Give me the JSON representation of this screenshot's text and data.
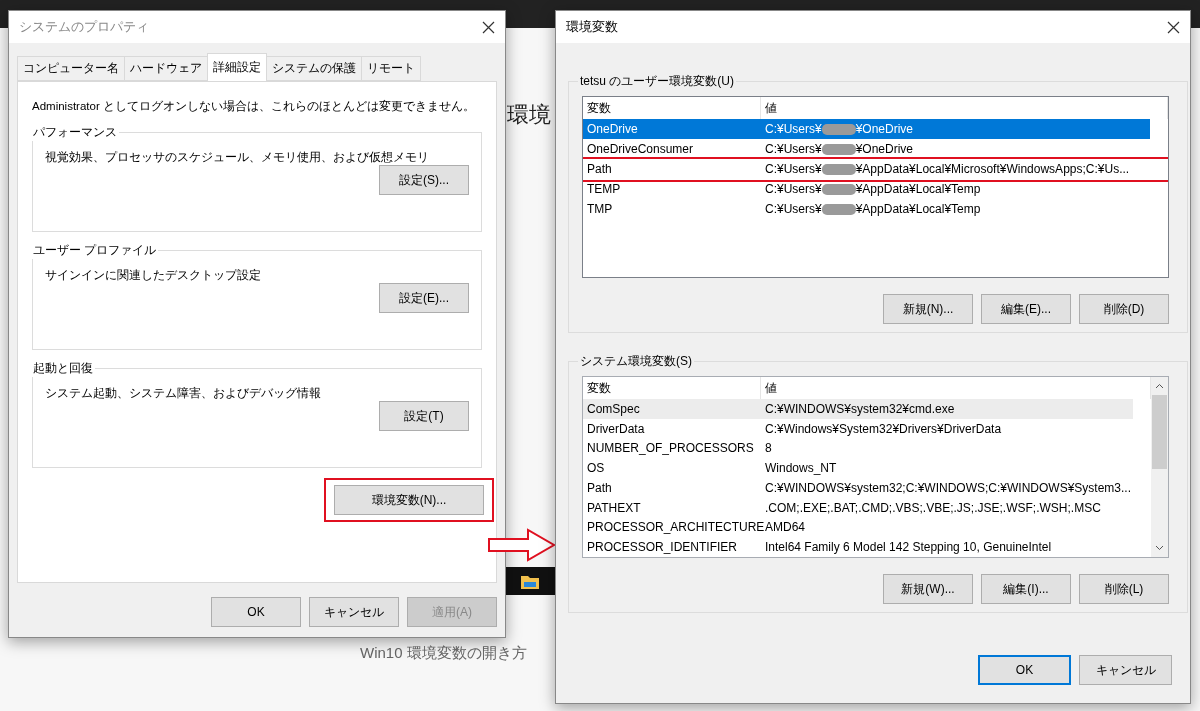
{
  "background": {
    "heading_fragment": "環境",
    "caption": "Win10 環境変数の開き方"
  },
  "system_properties": {
    "title": "システムのプロパティ",
    "tabs": [
      {
        "label": "コンピューター名",
        "selected": false
      },
      {
        "label": "ハードウェア",
        "selected": false
      },
      {
        "label": "詳細設定",
        "selected": true
      },
      {
        "label": "システムの保護",
        "selected": false
      },
      {
        "label": "リモート",
        "selected": false
      }
    ],
    "notice": "Administrator としてログオンしない場合は、これらのほとんどは変更できません。",
    "groups": [
      {
        "label": "パフォーマンス",
        "description": "視覚効果、プロセッサのスケジュール、メモリ使用、および仮想メモリ",
        "button": "設定(S)..."
      },
      {
        "label": "ユーザー プロファイル",
        "description": "サインインに関連したデスクトップ設定",
        "button": "設定(E)..."
      },
      {
        "label": "起動と回復",
        "description": "システム起動、システム障害、およびデバッグ情報",
        "button": "設定(T)"
      }
    ],
    "env_button": {
      "label": "環境変数(N)...",
      "highlighted": true
    },
    "buttons": [
      {
        "label": "OK",
        "disabled": false
      },
      {
        "label": "キャンセル",
        "disabled": false
      },
      {
        "label": "適用(A)",
        "disabled": true
      }
    ]
  },
  "environment_variables": {
    "title": "環境変数",
    "user_group": {
      "label": "tetsu のユーザー環境変数(U)",
      "focused": true,
      "columns": [
        "変数",
        "値"
      ],
      "rows": [
        {
          "name": "OneDrive",
          "value": {
            "before": "C:¥Users¥",
            "redacted": true,
            "after": "¥OneDrive"
          },
          "selected": true,
          "highlighted": false
        },
        {
          "name": "OneDriveConsumer",
          "value": {
            "before": "C:¥Users¥",
            "redacted": true,
            "after": "¥OneDrive"
          },
          "selected": false,
          "highlighted": false
        },
        {
          "name": "Path",
          "value": {
            "before": "C:¥Users¥",
            "redacted": true,
            "after": "¥AppData¥Local¥Microsoft¥WindowsApps;C:¥Us..."
          },
          "selected": false,
          "highlighted": true
        },
        {
          "name": "TEMP",
          "value": {
            "before": "C:¥Users¥",
            "redacted": true,
            "after": "¥AppData¥Local¥Temp"
          },
          "selected": false,
          "highlighted": false
        },
        {
          "name": "TMP",
          "value": {
            "before": "C:¥Users¥",
            "redacted": true,
            "after": "¥AppData¥Local¥Temp"
          },
          "selected": false,
          "highlighted": false
        }
      ],
      "buttons": [
        "新規(N)...",
        "編集(E)...",
        "削除(D)"
      ]
    },
    "system_group": {
      "label": "システム環境変数(S)",
      "focused": false,
      "scrollable": true,
      "columns": [
        "変数",
        "値"
      ],
      "rows": [
        {
          "name": "ComSpec",
          "value": "C:¥WINDOWS¥system32¥cmd.exe",
          "selected": true,
          "highlighted": false
        },
        {
          "name": "DriverData",
          "value": "C:¥Windows¥System32¥Drivers¥DriverData",
          "selected": false,
          "highlighted": false
        },
        {
          "name": "NUMBER_OF_PROCESSORS",
          "value": "8",
          "selected": false,
          "highlighted": false
        },
        {
          "name": "OS",
          "value": "Windows_NT",
          "selected": false,
          "highlighted": false
        },
        {
          "name": "Path",
          "value": "C:¥WINDOWS¥system32;C:¥WINDOWS;C:¥WINDOWS¥System3...",
          "selected": false,
          "highlighted": false
        },
        {
          "name": "PATHEXT",
          "value": ".COM;.EXE;.BAT;.CMD;.VBS;.VBE;.JS;.JSE;.WSF;.WSH;.MSC",
          "selected": false,
          "highlighted": false
        },
        {
          "name": "PROCESSOR_ARCHITECTURE",
          "value": "AMD64",
          "selected": false,
          "highlighted": false
        },
        {
          "name": "PROCESSOR_IDENTIFIER",
          "value": "Intel64 Family 6 Model 142 Stepping 10, GenuineIntel",
          "selected": false,
          "highlighted": false
        }
      ],
      "buttons": [
        "新規(W)...",
        "編集(I)...",
        "削除(L)"
      ]
    },
    "buttons": [
      {
        "label": "OK",
        "default": true
      },
      {
        "label": "キャンセル",
        "default": false
      }
    ]
  }
}
